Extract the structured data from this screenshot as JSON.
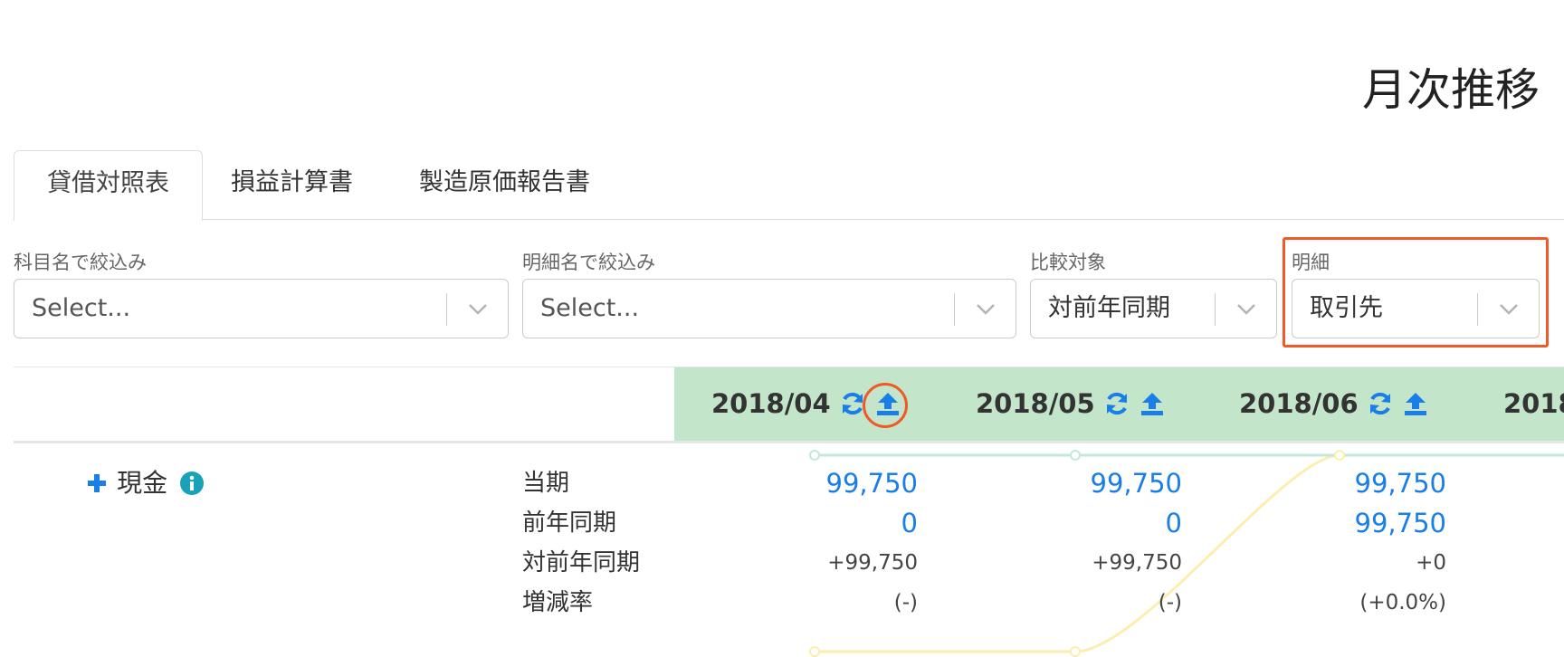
{
  "page": {
    "title": "月次推移"
  },
  "tabs": [
    {
      "label": "貸借対照表",
      "active": true
    },
    {
      "label": "損益計算書",
      "active": false
    },
    {
      "label": "製造原価報告書",
      "active": false
    }
  ],
  "filters": {
    "account": {
      "label": "科目名で絞込み",
      "placeholder": "Select..."
    },
    "detail_name": {
      "label": "明細名で絞込み",
      "placeholder": "Select..."
    },
    "comparison": {
      "label": "比較対象",
      "value": "対前年同期"
    },
    "detail": {
      "label": "明細",
      "value": "取引先"
    }
  },
  "months": [
    {
      "label": "2018/04"
    },
    {
      "label": "2018/05"
    },
    {
      "label": "2018/06"
    },
    {
      "label": "2018"
    }
  ],
  "row": {
    "account_name": "現金",
    "labels": {
      "current": "当期",
      "prior": "前年同期",
      "diff": "対前年同期",
      "rate": "増減率"
    },
    "values": [
      {
        "current": "99,750",
        "prior": "0",
        "diff": "+99,750",
        "rate": "(-)"
      },
      {
        "current": "99,750",
        "prior": "0",
        "diff": "+99,750",
        "rate": "(-)"
      },
      {
        "current": "99,750",
        "prior": "99,750",
        "diff": "+0",
        "rate": "(+0.0%)"
      }
    ]
  },
  "colors": {
    "accent": "#1a7ee8",
    "highlight": "#f05a28",
    "header_band": "#c3e6cb",
    "sparkline_current": "#c3e6dd",
    "sparkline_prior": "#fdeeb0",
    "info_badge": "#17a2b8"
  },
  "icons": {
    "refresh": "refresh-icon",
    "upload": "upload-icon",
    "expand": "plus-icon",
    "info": "info-icon",
    "dropdown": "chevron-down-icon"
  }
}
